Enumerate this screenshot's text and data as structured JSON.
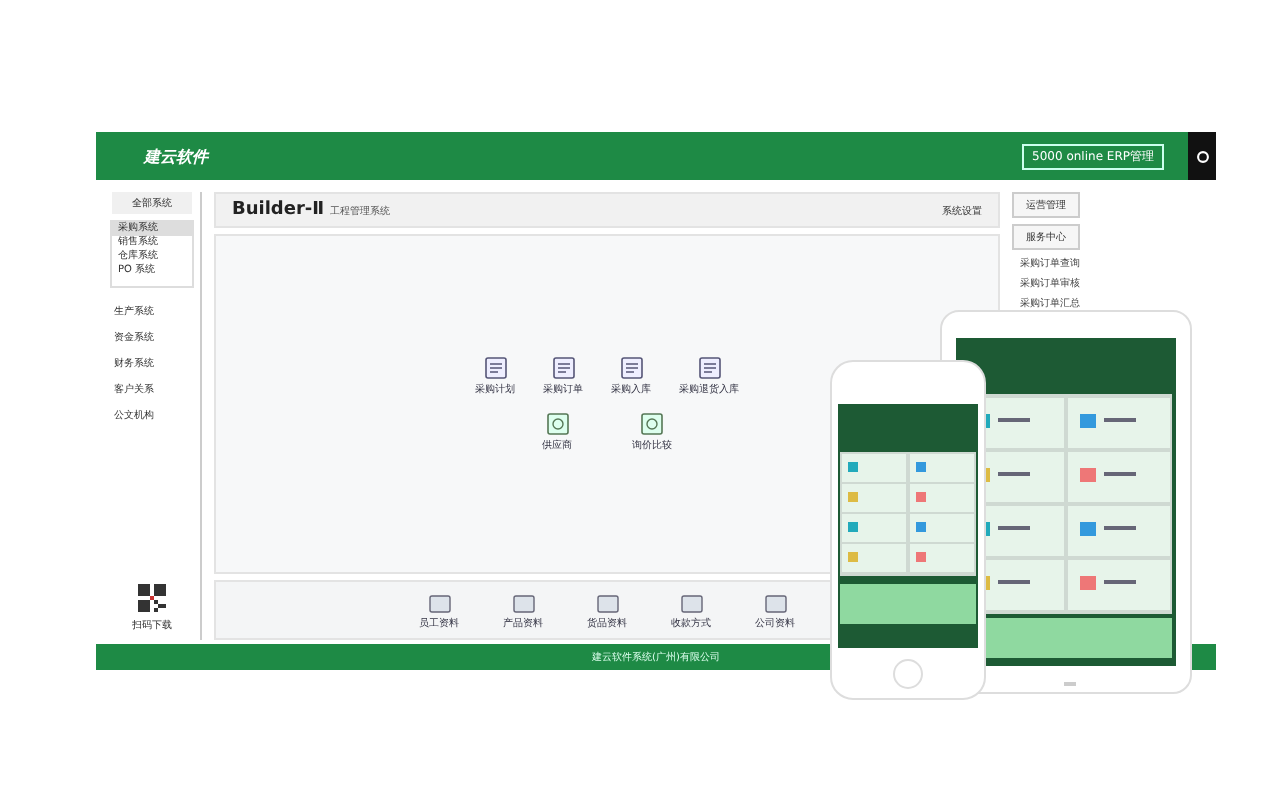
{
  "header": {
    "logo": "建云软件",
    "badge": "5000 online ERP管理"
  },
  "sidebar": {
    "title": "全部系统",
    "submenu": [
      {
        "label": "采购系统",
        "selected": true
      },
      {
        "label": "销售系统",
        "selected": false
      },
      {
        "label": "仓库系统",
        "selected": false
      },
      {
        "label": "PO 系统",
        "selected": false
      }
    ],
    "items": [
      "生产系统",
      "资金系统",
      "财务系统",
      "客户关系",
      "公文机构"
    ],
    "qr_label": "扫码下载"
  },
  "main": {
    "title": "Builder-Ⅱ",
    "subtitle": "工程管理系统",
    "link": "系统设置",
    "flow": [
      {
        "label": "采购计划"
      },
      {
        "label": "采购订单"
      },
      {
        "label": "采购入库"
      },
      {
        "label": "采购退货入库"
      }
    ],
    "flow_sub": [
      {
        "label": "供应商"
      },
      {
        "label": "询价比较"
      }
    ],
    "shortcuts": [
      "员工资料",
      "产品资料",
      "货品资料",
      "收款方式",
      "公司资料"
    ]
  },
  "right": {
    "buttons": [
      "运营管理",
      "服务中心"
    ],
    "list": [
      "采购订单查询",
      "采购订单审核",
      "采购订单汇总"
    ]
  },
  "footer": "建云软件系统(广州)有限公司"
}
